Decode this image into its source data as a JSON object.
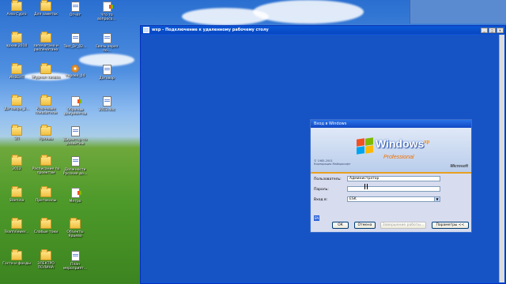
{
  "desktop": {
    "icons": [
      {
        "label": "Area Cypro",
        "type": "folder"
      },
      {
        "label": "Для заметок",
        "type": "folder"
      },
      {
        "label": "Отчёт",
        "type": "doc"
      },
      {
        "label": "Что то вопросо...",
        "type": "page-win"
      },
      {
        "label": "архив 2010",
        "type": "folder"
      },
      {
        "label": "запечатано и распечатано",
        "type": "folder"
      },
      {
        "label": "Test_Dr_02...",
        "type": "doc"
      },
      {
        "label": "Связь через по...",
        "type": "doc"
      },
      {
        "label": "ИНВЕНТ",
        "type": "folder"
      },
      {
        "label": "Журнал заявок",
        "type": "folder"
      },
      {
        "label": "перово_04",
        "type": "app"
      },
      {
        "label": "Договор",
        "type": "doc"
      },
      {
        "label": "Договора_2...",
        "type": "folder"
      },
      {
        "label": "Ключевые показатели",
        "type": "folder"
      },
      {
        "label": "Образцы документов",
        "type": "page-win"
      },
      {
        "label": "2013.doc",
        "type": "doc"
      },
      {
        "label": "ЗП",
        "type": "folder"
      },
      {
        "label": "Архивы",
        "type": "folder"
      },
      {
        "label": "Директор по развитию",
        "type": "doc"
      },
      {
        "label": "",
        "type": "none"
      },
      {
        "label": "2012",
        "type": "folder"
      },
      {
        "label": "Расписание по проектам",
        "type": "folder"
      },
      {
        "label": "Должности Русские до...",
        "type": "doc"
      },
      {
        "label": "",
        "type": "none"
      },
      {
        "label": "Stamina",
        "type": "folder"
      },
      {
        "label": "Протоколы",
        "type": "folder"
      },
      {
        "label": "Метро",
        "type": "page-win"
      },
      {
        "label": "",
        "type": "none"
      },
      {
        "label": "TeamViewer...",
        "type": "folder"
      },
      {
        "label": "Слабые токи",
        "type": "folder"
      },
      {
        "label": "Объекты Ярцево",
        "type": "folder"
      },
      {
        "label": "",
        "type": "none"
      },
      {
        "label": "Гости и фонды",
        "type": "folder"
      },
      {
        "label": "ЭЛЕКТРО ПОЛИНА",
        "type": "folder"
      },
      {
        "label": "План мероприят...",
        "type": "doc"
      },
      {
        "label": "",
        "type": "none"
      }
    ]
  },
  "rdp": {
    "title": "wxp - Подключение к удаленному рабочему столу",
    "btn_min": "_",
    "btn_max": "□",
    "btn_close": "×"
  },
  "login": {
    "title": "Вход в Windows",
    "brand": "Windows",
    "brand_sup": "xp",
    "edition": "Professional",
    "copyright": "© 1985-2001\nКорпорация Майкрософт",
    "ms_logo": "Microsoft",
    "username_label": "Пользователь:",
    "username_value": "Администратор",
    "password_label": "Пароль:",
    "password_value": "",
    "domain_label": "Вход в:",
    "domain_value": "ESK",
    "keyboard_indicator": "EN",
    "ok_label": "ОК",
    "cancel_label": "Отмена",
    "shutdown_label": "Завершение работы...",
    "options_label": "Параметры <<"
  },
  "colors": {
    "rdp_background": "#1654c6",
    "xp_title": "#0a58d8",
    "dialog_bg": "#d7dcef"
  }
}
